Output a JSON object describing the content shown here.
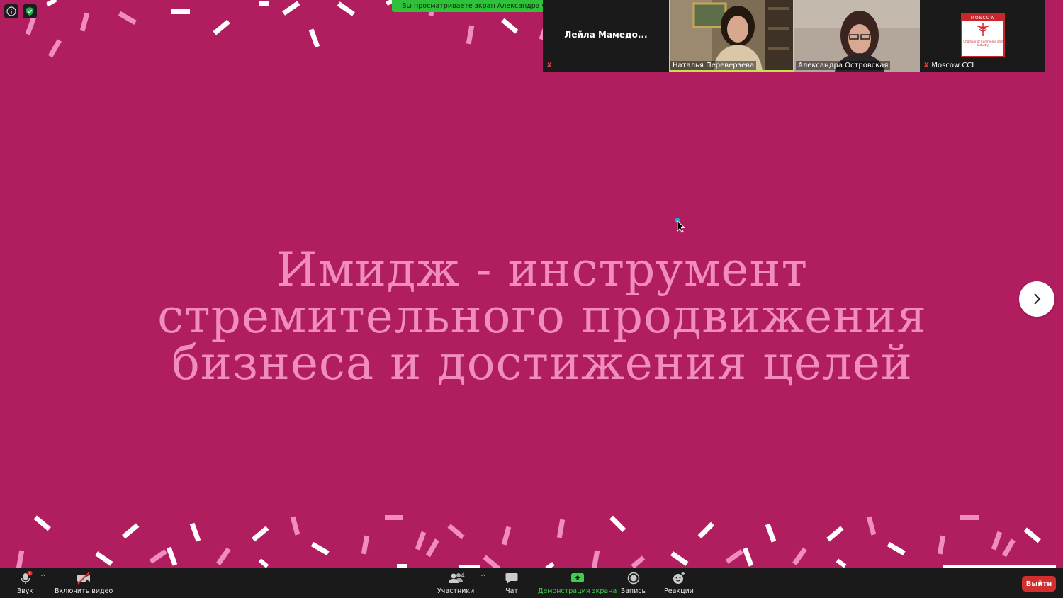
{
  "window": {
    "share_banner": "Вы просматриваете экран Александра Островская"
  },
  "slide": {
    "title_lines": [
      "Имидж - инструмент",
      "стремительного продвижения",
      "бизнеса и достижения целей"
    ],
    "next_icon": "chevron-right-icon",
    "background_color": "#b01e60",
    "title_color": "#f08cbf"
  },
  "participants": [
    {
      "name": "Лейла  Мамедо...",
      "muted": true
    },
    {
      "name": "Наталья Переверзева",
      "muted": false
    },
    {
      "name": "Александра Островская",
      "muted": false
    },
    {
      "name": "Moscow CCI",
      "muted": true
    }
  ],
  "cci_logo": {
    "top_text": "MOSCOW",
    "bottom_text": "Chamber of Commerce and Industry"
  },
  "toolbar": {
    "audio_label": "Звук",
    "audio_badge": "!",
    "video_label": "Включить видео",
    "participants_label": "Участники",
    "participants_count": "4",
    "chat_label": "Чат",
    "share_label": "Демонстрация экрана",
    "record_label": "Запись",
    "reactions_label": "Реакции",
    "leave_label": "Выйти",
    "share_color": "#3ecf4e",
    "leave_color": "#d32f2f"
  }
}
